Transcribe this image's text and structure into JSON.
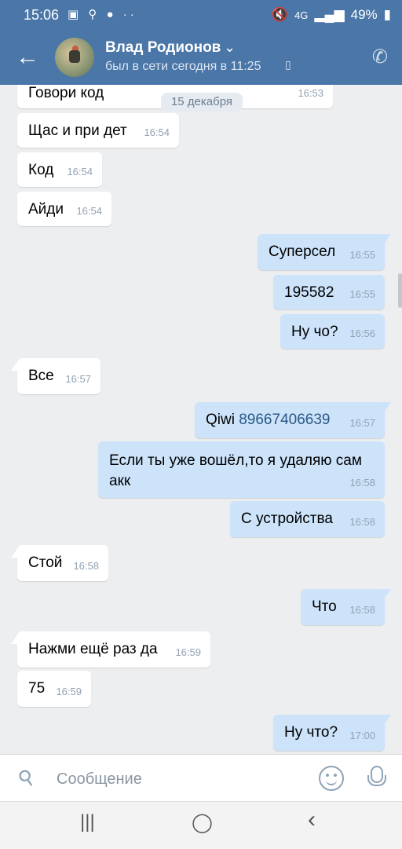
{
  "status_bar": {
    "time": "15:06",
    "left_icons": "▣ ⚲ ● ··",
    "network": "4G",
    "battery": "49%"
  },
  "header": {
    "back_icon": "arrow-left-icon",
    "name": "Влад Родионов",
    "chevron": "⌄",
    "last_seen": "был в сети сегодня в 11:25",
    "call_icon": "phone-icon"
  },
  "chat": {
    "date_chip": "15 декабря",
    "messages": [
      {
        "dir": "in",
        "text": "Говори код",
        "time": "16:53"
      },
      {
        "dir": "in",
        "text": "Щас и при дет",
        "time": "16:54"
      },
      {
        "dir": "in",
        "text": "Код",
        "time": "16:54"
      },
      {
        "dir": "in",
        "text": "Айди",
        "time": "16:54"
      },
      {
        "dir": "out",
        "text": "Суперсел",
        "time": "16:55"
      },
      {
        "dir": "out",
        "text": "195582",
        "time": "16:55"
      },
      {
        "dir": "out",
        "text": "Ну чо?",
        "time": "16:56"
      },
      {
        "dir": "in",
        "text": "Все",
        "time": "16:57"
      },
      {
        "dir": "out",
        "prefix": "Qiwi ",
        "link": "89667406639",
        "time": "16:57"
      },
      {
        "dir": "out",
        "text": "Если ты уже вошёл,то я удаляю сам акк",
        "time": "16:58"
      },
      {
        "dir": "out",
        "text": "С устройства",
        "time": "16:58"
      },
      {
        "dir": "in",
        "text": "Стой",
        "time": "16:58"
      },
      {
        "dir": "out",
        "text": "Что",
        "time": "16:58"
      },
      {
        "dir": "in",
        "text": "Нажми ещё раз да",
        "time": "16:59"
      },
      {
        "dir": "in",
        "text": "75",
        "time": "16:59"
      },
      {
        "dir": "out",
        "text": "Ну что?",
        "time": "17:00"
      }
    ]
  },
  "composer": {
    "placeholder": "Сообщение",
    "attach_icon": "paperclip-icon",
    "emoji_icon": "smile-icon",
    "mic_icon": "microphone-icon"
  },
  "nav": {
    "recent": "|||",
    "home": "◯",
    "back": "‹"
  },
  "colors": {
    "header": "#4a76a8",
    "incoming": "#ffffff",
    "outgoing": "#cce3fa",
    "background": "#edeef0"
  }
}
